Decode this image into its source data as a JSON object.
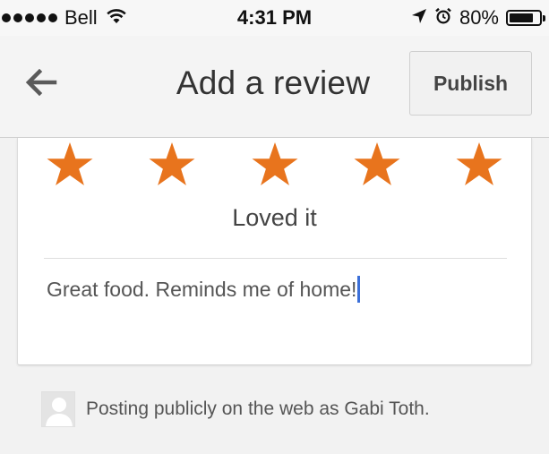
{
  "status_bar": {
    "carrier": "Bell",
    "time": "4:31 PM",
    "battery_percent": "80%",
    "battery_level": 0.8,
    "icons": [
      "signal-dots-icon",
      "wifi-icon",
      "location-arrow-icon",
      "alarm-icon",
      "battery-icon"
    ]
  },
  "header": {
    "title": "Add a review",
    "back_icon": "arrow-left-icon",
    "publish_label": "Publish"
  },
  "review": {
    "rating": 5,
    "max_rating": 5,
    "star_color": "#e8741d",
    "rating_label": "Loved it",
    "text": "Great food. Reminds me of home!",
    "caret_color": "#3b6fd8"
  },
  "footer": {
    "avatar_icon": "person-silhouette-icon",
    "posting_text": "Posting publicly on the web as Gabi Toth."
  }
}
